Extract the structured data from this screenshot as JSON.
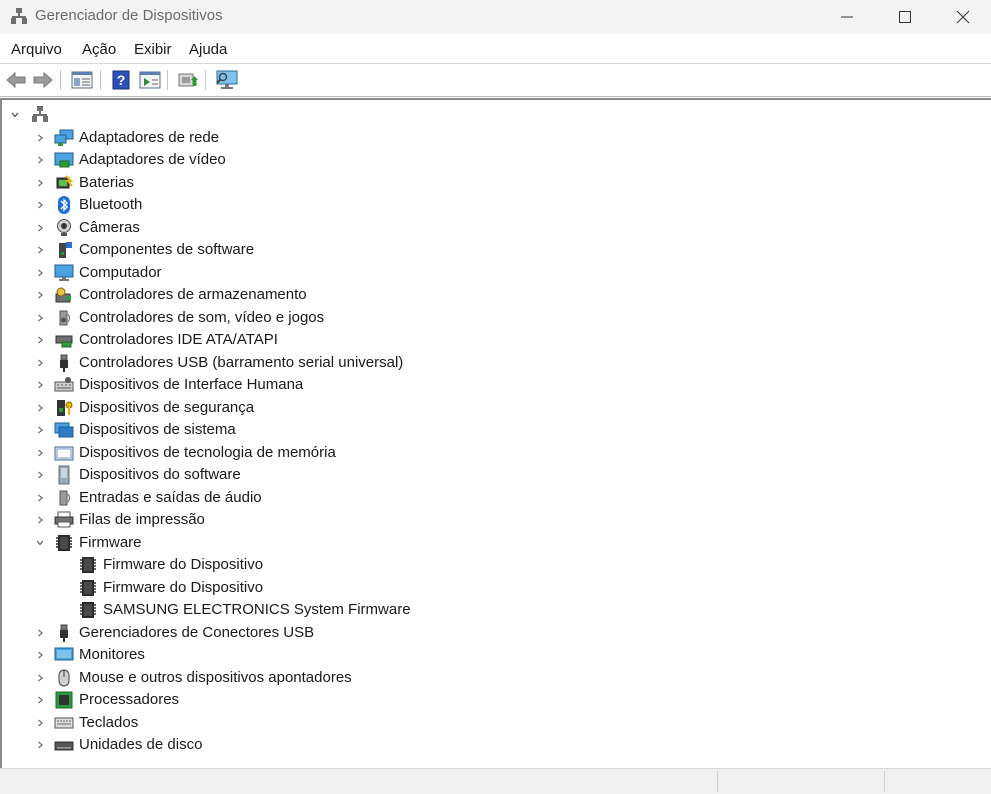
{
  "window": {
    "title": "Gerenciador de Dispositivos",
    "minimize": "minimize-icon",
    "maximize": "maximize-icon",
    "close": "close-icon"
  },
  "menu": {
    "items": [
      "Arquivo",
      "Ação",
      "Exibir",
      "Ajuda"
    ]
  },
  "toolbar": {
    "buttons": [
      "back-arrow-icon",
      "forward-arrow-icon",
      "properties-icon",
      "help-icon",
      "run-icon",
      "update-driver-icon",
      "scan-hardware-icon"
    ]
  },
  "tree": {
    "root_expanded": true,
    "categories": [
      {
        "label": "Adaptadores de rede",
        "icon": "network-adapter-icon"
      },
      {
        "label": "Adaptadores de vídeo",
        "icon": "display-adapter-icon"
      },
      {
        "label": "Baterias",
        "icon": "battery-icon"
      },
      {
        "label": "Bluetooth",
        "icon": "bluetooth-icon"
      },
      {
        "label": "Câmeras",
        "icon": "camera-icon"
      },
      {
        "label": "Componentes de software",
        "icon": "software-component-icon"
      },
      {
        "label": "Computador",
        "icon": "computer-icon"
      },
      {
        "label": "Controladores de armazenamento",
        "icon": "storage-controller-icon"
      },
      {
        "label": "Controladores de som, vídeo e jogos",
        "icon": "speaker-icon"
      },
      {
        "label": "Controladores IDE ATA/ATAPI",
        "icon": "ide-controller-icon"
      },
      {
        "label": "Controladores USB (barramento serial universal)",
        "icon": "usb-icon"
      },
      {
        "label": "Dispositivos de Interface Humana",
        "icon": "hid-icon"
      },
      {
        "label": "Dispositivos de segurança",
        "icon": "security-device-icon"
      },
      {
        "label": "Dispositivos de sistema",
        "icon": "system-device-icon"
      },
      {
        "label": "Dispositivos de tecnologia de memória",
        "icon": "memory-technology-icon"
      },
      {
        "label": "Dispositivos do software",
        "icon": "software-device-icon"
      },
      {
        "label": "Entradas e saídas de áudio",
        "icon": "audio-io-icon"
      },
      {
        "label": "Filas de impressão",
        "icon": "printer-icon"
      },
      {
        "label": "Firmware",
        "icon": "firmware-icon",
        "expanded": true,
        "children": [
          "Firmware do Dispositivo",
          "Firmware do Dispositivo",
          "SAMSUNG ELECTRONICS System Firmware"
        ]
      },
      {
        "label": "Gerenciadores de Conectores USB",
        "icon": "usb-connector-icon"
      },
      {
        "label": "Monitores",
        "icon": "monitor-icon"
      },
      {
        "label": "Mouse e outros dispositivos apontadores",
        "icon": "mouse-icon"
      },
      {
        "label": "Processadores",
        "icon": "processor-icon"
      },
      {
        "label": "Teclados",
        "icon": "keyboard-icon"
      },
      {
        "label": "Unidades de disco",
        "icon": "disk-drive-icon"
      }
    ]
  }
}
